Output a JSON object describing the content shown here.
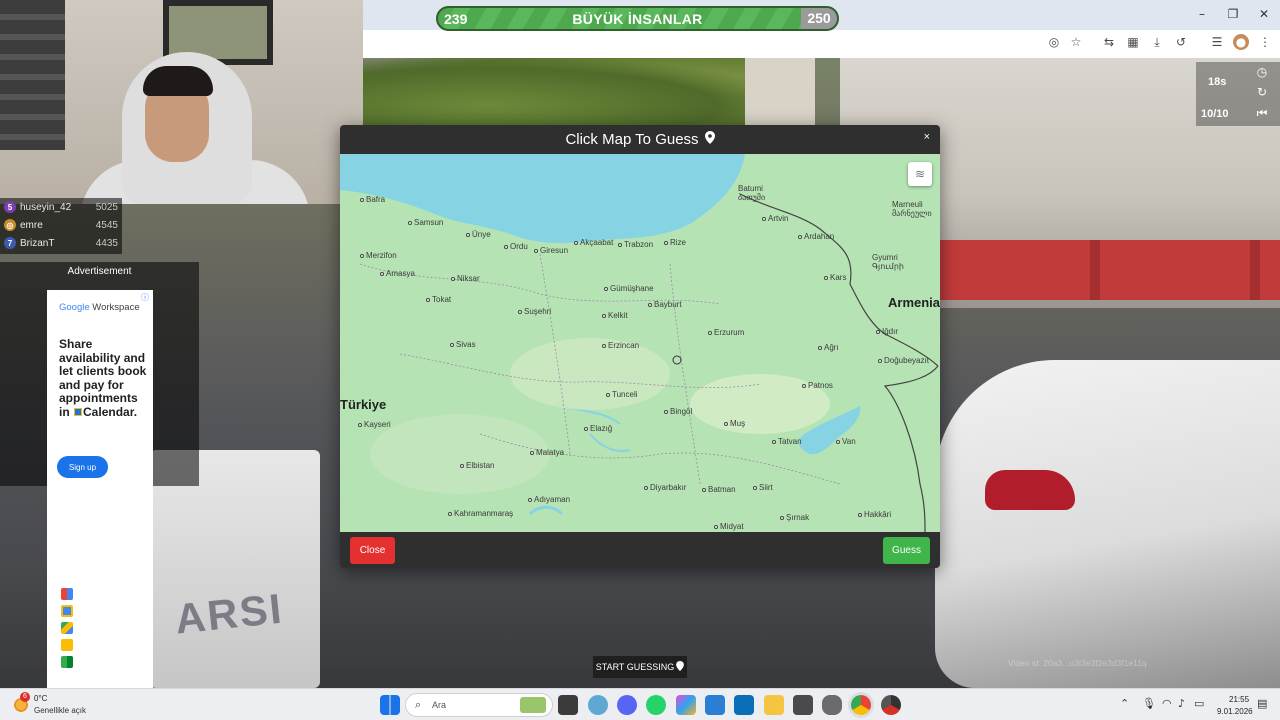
{
  "scoreboard": {
    "left_score": "239",
    "title": "BÜYÜK İNSANLAR",
    "right_score": "250"
  },
  "leaderboard": [
    {
      "rank": "5",
      "name": "huseyin_42",
      "score": "5025",
      "color": "#7b3fb0"
    },
    {
      "rank": "6",
      "name": "emre",
      "score": "4545",
      "color": "#c98a2a"
    },
    {
      "rank": "7",
      "name": "BrizanT",
      "score": "4435",
      "color": "#3f5bb0"
    }
  ],
  "ad": {
    "label": "Advertisement",
    "brand_google": "Google",
    "brand_workspace": "Workspace",
    "copy_prefix": "Share availability and let clients book and pay for appointments in",
    "copy_product": "Calendar.",
    "signup": "Sign up",
    "apps": [
      "gmail-icon",
      "calendar-icon",
      "drive-icon",
      "docs-icon",
      "meet-icon"
    ]
  },
  "hud": {
    "time": "18s",
    "round": "10/10"
  },
  "modal": {
    "title": "Click Map To Guess",
    "close_label": "Close",
    "guess_label": "Guess",
    "close_x": "×"
  },
  "map": {
    "country_labels": [
      "Türkiye",
      "Armenia"
    ],
    "cities": [
      "Bafra",
      "Samsun",
      "Ünye",
      "Ordu",
      "Giresun",
      "Akçaabat",
      "Trabzon",
      "Rize",
      "Batumi ბათუმი",
      "Artvin",
      "Ardahan",
      "Merzifon",
      "Amasya",
      "Niksar",
      "Gümüşhane",
      "Bayburt",
      "Kars",
      "Gyumri Գյումրի",
      "Tokat",
      "Suşehri",
      "Kelkit",
      "Erzurum",
      "Iğdır",
      "Sivas",
      "Erzincan",
      "Ağrı",
      "Doğubeyazıt",
      "Tunceli",
      "Patnos",
      "Kayseri",
      "Bingöl",
      "Muş",
      "Elazığ",
      "Tatvan",
      "Van",
      "Malatya",
      "Elbistan",
      "Adıyaman",
      "Diyarbakır",
      "Batman",
      "Siirt",
      "Kahramanmaraş",
      "Şırnak",
      "Hakkâri",
      "Midyat",
      "Marneuli მარნეული"
    ]
  },
  "start_guessing": "START GUESSING",
  "video_id": "Video id: 20a3...u3t3e3f2e3d3f1e11q",
  "taskbar": {
    "weather_badge": "6",
    "weather_temp": "0°C",
    "weather_desc": "Genellikle açık",
    "search_placeholder": "Ara",
    "time": "21:55",
    "date": "9.01.2026"
  }
}
